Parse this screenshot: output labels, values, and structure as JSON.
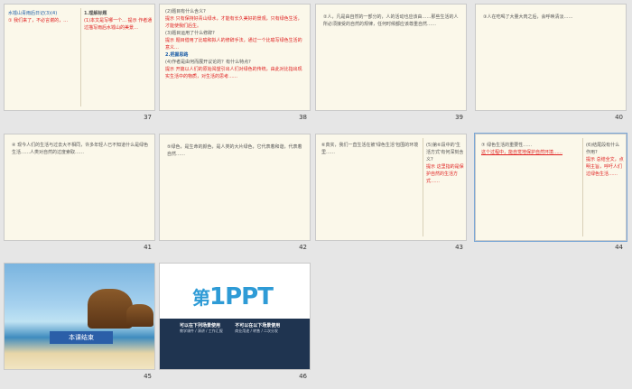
{
  "slides": [
    {
      "number": "37",
      "title": "水墟山青雨后日记(3)(4)",
      "left_text": "① 我们来了，不必言谢的，…",
      "right_head": "1.理解标题",
      "right_text": "(1)本文是写哪一个… 提示 作者通过描写雨后水墟山的美景…"
    },
    {
      "number": "38",
      "q1": "(2)题目有什么含义?",
      "tip1": "提示 只有保持好青山绿水，才能有长久美好的景观，只有绿色生活，才能使我们后生。",
      "q2": "(3)题目运用了什么修辞?",
      "tip2": "提示 题目借用了比喻和拟人的修辞手法，通过一个比喻写绿色生活的意义…",
      "head3": "2.把握思路",
      "q3": "(4)作者是由何而展开议论的？有什么特点?",
      "tip3": "提示 开篇以人们的原始渴望引出人们对绿色的传统，由此对比指出现实生活中的物质，对生活的思考……"
    },
    {
      "number": "39",
      "text": "②人，凡是由自然的一部分的，人的活动也应该由……那些生活的人所必须接受的自然的规律，任何时候都应该尊重自然……"
    },
    {
      "number": "40",
      "text": "③人在吃喝了大量大肉之后，会呼唤清淡……"
    },
    {
      "number": "41",
      "text": "④ 现今人们的生活与过去大不相同，许多年轻人已不知道什么是绿色生活……人类对自然的过度索取……"
    },
    {
      "number": "42",
      "text": "⑤绿色，是生命的颜色，是人类的大片绿色，它代表着和谐，代表着自然……"
    },
    {
      "number": "43",
      "text": "⑥真实，我们一直生活在被'绿色生活'包围的环境里……",
      "right_q": "(5)第⑥段中的'生活方式'有何深刻含义?",
      "right_tip": "提示 这里指的是保护自然的生活方式……"
    },
    {
      "number": "44",
      "text": "⑦ 绿色生活的重要性……",
      "underline": "这个过程中，能自觉地保护自然环境……",
      "right_q": "(6)结尾段有什么作用?",
      "right_tip": "提示 总结全文，点明主旨，呼吁人们过绿色生活……"
    },
    {
      "number": "45",
      "banner": "本课结束"
    },
    {
      "number": "46",
      "logo_prefix": "第",
      "logo_main": "1PPT",
      "col1_head": "可以在下列场景使用",
      "col1_text": "教学课件 / 演讲 / 工作汇报",
      "col2_head": "不可以在以下场景使用",
      "col2_text": "商业用途 / 转售 / 二次分发"
    }
  ],
  "colors": {
    "paper": "#fbf8ea",
    "accent_red": "#e02020",
    "accent_blue": "#1f5fa8",
    "tip_green": "#2f8a3a",
    "canvas": "#e6e6e6"
  }
}
